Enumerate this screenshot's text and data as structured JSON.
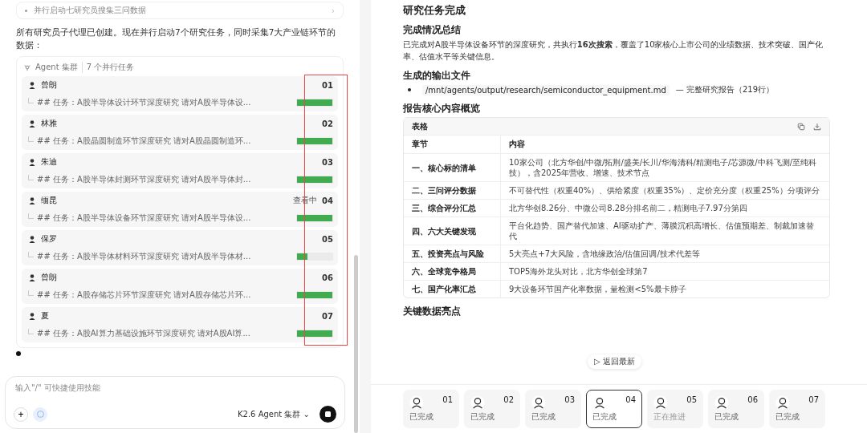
{
  "chat": {
    "prev_step": {
      "label": "并行启动七研究员搜集三问数据",
      "chevron": "›"
    },
    "message": "所有研究员子代理已创建。现在并行启动7个研究任务，同时采集7大产业链环节的数据：",
    "cluster": {
      "title": "Agent 集群",
      "subtitle": "7 个并行任务",
      "highlight_progress": true,
      "agents": [
        {
          "name": "曾朗",
          "number": "01",
          "task": "## 任务：A股半导体设计环节深度研究 请对A股半导体设...",
          "level": 1
        },
        {
          "name": "林雅",
          "number": "02",
          "task": "## 任务：A股晶圆制造环节深度研究 请对A股晶圆制造环...",
          "level": 1
        },
        {
          "name": "朱迪",
          "number": "03",
          "task": "## 任务：A股半导体封测环节深度研究 请对A股半导体封...",
          "level": 1
        },
        {
          "name": "缅昆",
          "number": "04",
          "task": "## 任务：A股半导体设备环节深度研究 请对A股半导体设...",
          "level": 1,
          "viewing_label": "查看中"
        },
        {
          "name": "保罗",
          "number": "05",
          "task": "## 任务：A股半导体材料环节深度研究 请对A股半导体材...",
          "level": 0.3
        },
        {
          "name": "曾朗",
          "number": "06",
          "task": "## 任务：A股存储芯片环节深度研究 请对A股存储芯片环...",
          "level": 1
        },
        {
          "name": "夏",
          "number": "07",
          "task": "## 任务：A股AI算力基础设施环节深度研究 请对A股AI算...",
          "level": 1
        }
      ]
    }
  },
  "composer": {
    "placeholder": "输入\"/\" 可快捷使用技能",
    "add": "+",
    "model": "K2.6 Agent 集群",
    "caret": "⌄"
  },
  "report": {
    "title": "研究任务完成",
    "sections": [
      {
        "kind": "paragraph",
        "heading": "完成情况总结",
        "text": "已完成对A股半导体设备环节的深度研究，共执行**16次搜索**，覆盖了10家核心上市公司的业绩数据、技术突破、国产化率、估值水平等关键信息。"
      },
      {
        "kind": "files",
        "heading": "生成的输出文件",
        "items": [
          {
            "path": "/mnt/agents/output/research/semiconductor_equipment.md",
            "note": "— 完整研究报告（219行）"
          }
        ]
      },
      {
        "kind": "table",
        "heading": "报告核心内容概览",
        "table": {
          "title": "表格",
          "columns": [
            "章节",
            "内容"
          ],
          "rows": [
            [
              "一、核心标的清单",
              "10家公司（北方华创/中微/拓荆/盛美/长川/华海清科/精测电子/芯源微/中科飞测/至纯科技），含2025年营收、增速、技术节点"
            ],
            [
              "二、三问评分数据",
              "不可替代性（权重40%）、供给紧度（权重35%）、定价充分度（权重25%）分项评分"
            ],
            [
              "三、综合评分汇总",
              "北方华创8.26分、中微公司8.28分排名前二，精测电子7.97分第四"
            ],
            [
              "四、六大关键发现",
              "平台化趋势、国产替代加速、AI驱动扩产、薄膜沉积高增长、估值预期差、制裁加速替代"
            ],
            [
              "五、投资亮点与风险",
              "5大亮点+7大风险，含地缘政治/估值回调/技术代差等"
            ],
            [
              "六、全球竞争格局",
              "TOP5海外龙头对比，北方华创全球第7"
            ],
            [
              "七、国产化率汇总",
              "9大设备环节国产化率数据，量检测<5%最卡脖子"
            ]
          ]
        }
      },
      {
        "kind": "heading",
        "heading": "关键数据亮点"
      }
    ],
    "back_to_latest": "返回最新",
    "back_icon": "▷"
  },
  "agent_bar": [
    {
      "number": "01",
      "status": "已完成",
      "done": true,
      "selected": false
    },
    {
      "number": "02",
      "status": "已完成",
      "done": true,
      "selected": false
    },
    {
      "number": "03",
      "status": "已完成",
      "done": true,
      "selected": false
    },
    {
      "number": "04",
      "status": "已完成",
      "done": true,
      "selected": true
    },
    {
      "number": "05",
      "status": "正在推进",
      "done": false,
      "selected": false
    },
    {
      "number": "06",
      "status": "已完成",
      "done": true,
      "selected": false
    },
    {
      "number": "07",
      "status": "已完成",
      "done": true,
      "selected": false
    }
  ]
}
